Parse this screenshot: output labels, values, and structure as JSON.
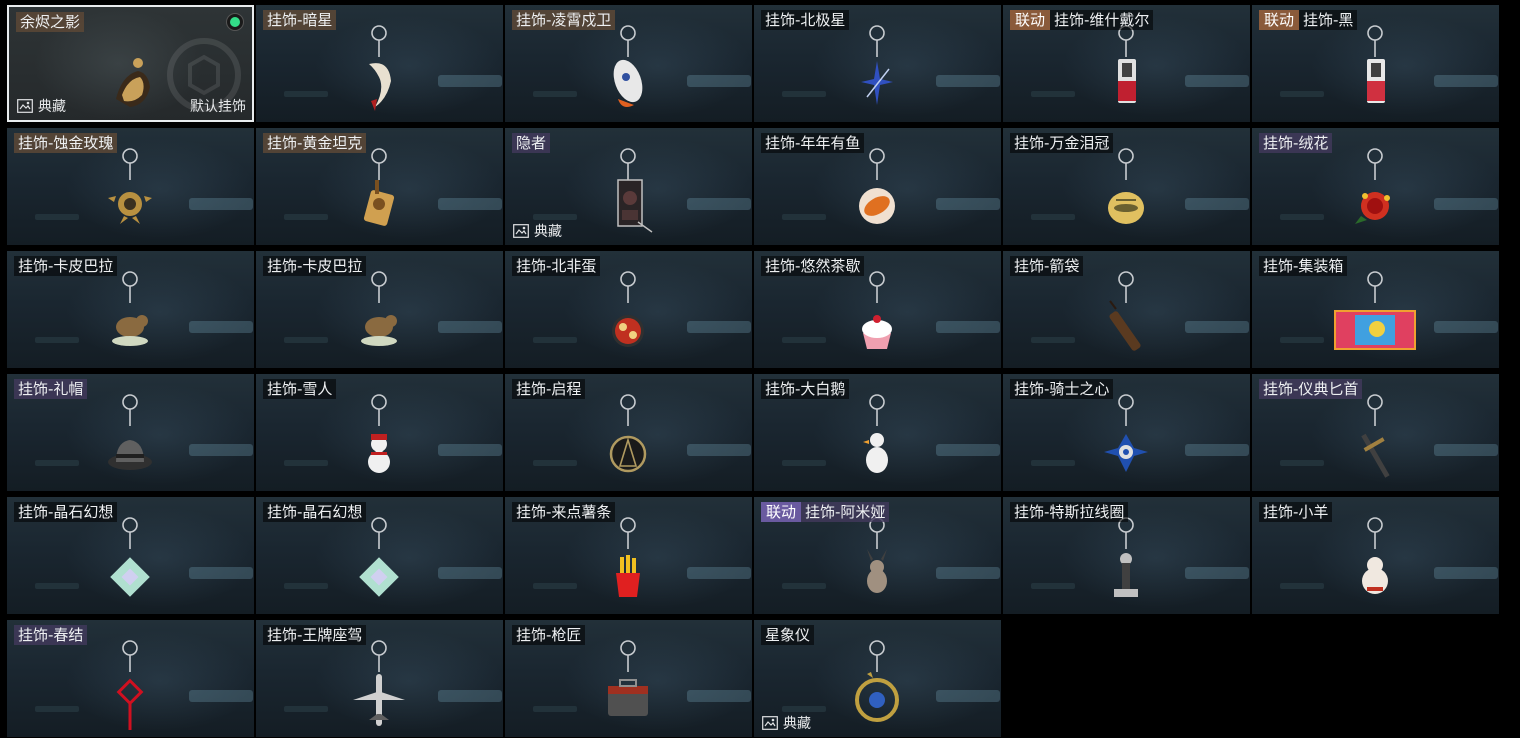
{
  "cards": [
    {
      "name": "余烬之影",
      "collab": "",
      "collab_color": "",
      "label_tint": "warm",
      "selected": true,
      "collection_badge": "典藏",
      "default_label": "默认挂饰",
      "equipped": true,
      "icon": "ember-shadow-figure-icon",
      "colors": [
        "#c9a15a",
        "#3a2a1a"
      ]
    },
    {
      "name": "挂饰-暗星",
      "collab": "",
      "label_tint": "warm",
      "icon": "crescent-moon-icon",
      "colors": [
        "#e8e0d0",
        "#b02020"
      ]
    },
    {
      "name": "挂饰-凌霄戍卫",
      "collab": "",
      "label_tint": "warm",
      "icon": "rocket-icon",
      "colors": [
        "#e8e8e8",
        "#e06020"
      ]
    },
    {
      "name": "挂饰-北极星",
      "collab": "",
      "label_tint": "dark",
      "icon": "north-star-icon",
      "colors": [
        "#3050c0",
        "#c0d0f0"
      ]
    },
    {
      "name": "挂饰-维什戴尔",
      "collab": "联动",
      "collab_color": "#8a5a3a",
      "label_tint": "dark",
      "icon": "gun-charm-icon",
      "colors": [
        "#e0e0e0",
        "#c02030"
      ]
    },
    {
      "name": "挂饰-黑",
      "collab": "联动",
      "collab_color": "#8a5a3a",
      "label_tint": "dark",
      "icon": "gun-charm-icon",
      "colors": [
        "#e8e8e8",
        "#d03040"
      ]
    },
    {
      "name": "挂饰-蚀金玫瑰",
      "collab": "",
      "label_tint": "warm",
      "icon": "gold-rose-icon",
      "colors": [
        "#b89040",
        "#3a3020"
      ]
    },
    {
      "name": "挂饰-黄金坦克",
      "collab": "",
      "label_tint": "warm",
      "icon": "gold-tank-icon",
      "colors": [
        "#d0a050",
        "#7a5020"
      ]
    },
    {
      "name": "隐者",
      "collab": "",
      "label_tint": "violet",
      "collection_badge": "典藏",
      "icon": "tarot-card-icon",
      "colors": [
        "#c0c0c0",
        "#5a3a3a"
      ]
    },
    {
      "name": "挂饰-年年有鱼",
      "collab": "",
      "label_tint": "dark",
      "icon": "fish-plate-icon",
      "colors": [
        "#e07020",
        "#f0e0d0"
      ]
    },
    {
      "name": "挂饰-万金泪冠",
      "collab": "",
      "label_tint": "dark",
      "icon": "gold-crown-icon",
      "colors": [
        "#e0c060",
        "#6a6030"
      ]
    },
    {
      "name": "挂饰-绒花",
      "collab": "",
      "label_tint": "violet",
      "icon": "velvet-flower-icon",
      "colors": [
        "#d03020",
        "#f0c030"
      ]
    },
    {
      "name": "挂饰-卡皮巴拉",
      "collab": "",
      "label_tint": "dark",
      "icon": "capybara-icon",
      "colors": [
        "#8a6a40",
        "#d0d8c0"
      ]
    },
    {
      "name": "挂饰-卡皮巴拉",
      "collab": "",
      "label_tint": "dark",
      "icon": "capybara-icon",
      "colors": [
        "#8a6a40",
        "#d0d8c0"
      ]
    },
    {
      "name": "挂饰-北非蛋",
      "collab": "",
      "label_tint": "dark",
      "icon": "shakshuka-icon",
      "colors": [
        "#c03020",
        "#f0d080"
      ]
    },
    {
      "name": "挂饰-悠然茶歇",
      "collab": "",
      "label_tint": "dark",
      "icon": "cupcake-icon",
      "colors": [
        "#f0a0b0",
        "#ffffff"
      ]
    },
    {
      "name": "挂饰-箭袋",
      "collab": "",
      "label_tint": "dark",
      "icon": "quiver-icon",
      "colors": [
        "#5a3a20",
        "#2a1a10"
      ]
    },
    {
      "name": "挂饰-集装箱",
      "collab": "",
      "label_tint": "dark",
      "icon": "container-icon",
      "colors": [
        "#e04060",
        "#40a0e0"
      ]
    },
    {
      "name": "挂饰-礼帽",
      "collab": "",
      "label_tint": "violet",
      "icon": "fedora-hat-icon",
      "colors": [
        "#606060",
        "#303030"
      ]
    },
    {
      "name": "挂饰-雪人",
      "collab": "",
      "label_tint": "dark",
      "icon": "snowman-icon",
      "colors": [
        "#f0f0f0",
        "#c02020"
      ]
    },
    {
      "name": "挂饰-启程",
      "collab": "",
      "label_tint": "dark",
      "icon": "compass-medal-icon",
      "colors": [
        "#b09a60",
        "#1a1a1a"
      ]
    },
    {
      "name": "挂饰-大白鹅",
      "collab": "",
      "label_tint": "dark",
      "icon": "goose-icon",
      "colors": [
        "#f0f0f0",
        "#f0a030"
      ]
    },
    {
      "name": "挂饰-骑士之心",
      "collab": "",
      "label_tint": "dark",
      "icon": "knight-cross-icon",
      "colors": [
        "#2050b0",
        "#e0e0e0"
      ]
    },
    {
      "name": "挂饰-仪典匕首",
      "collab": "",
      "label_tint": "violet",
      "icon": "dagger-icon",
      "colors": [
        "#404040",
        "#a08040"
      ]
    },
    {
      "name": "挂饰-晶石幻想",
      "collab": "",
      "label_tint": "dark",
      "icon": "crystal-cube-icon",
      "colors": [
        "#b0e0d0",
        "#d0d0f0"
      ]
    },
    {
      "name": "挂饰-晶石幻想",
      "collab": "",
      "label_tint": "dark",
      "icon": "crystal-cube-icon",
      "colors": [
        "#b0e0d0",
        "#d0d0f0"
      ]
    },
    {
      "name": "挂饰-来点薯条",
      "collab": "",
      "label_tint": "dark",
      "icon": "french-fries-icon",
      "colors": [
        "#e02020",
        "#f0c020"
      ]
    },
    {
      "name": "挂饰-阿米娅",
      "collab": "联动",
      "collab_color": "#6a5aa0",
      "label_tint": "violet",
      "icon": "rabbit-icon",
      "colors": [
        "#a09080",
        "#404040"
      ]
    },
    {
      "name": "挂饰-特斯拉线圈",
      "collab": "",
      "label_tint": "dark",
      "icon": "tesla-coil-icon",
      "colors": [
        "#c0c0c0",
        "#404040"
      ]
    },
    {
      "name": "挂饰-小羊",
      "collab": "",
      "label_tint": "dark",
      "icon": "lamb-icon",
      "colors": [
        "#f0e8e0",
        "#c03020"
      ]
    },
    {
      "name": "挂饰-春结",
      "collab": "",
      "label_tint": "violet",
      "icon": "chinese-knot-icon",
      "colors": [
        "#d01020",
        "#c0a060"
      ]
    },
    {
      "name": "挂饰-王牌座驾",
      "collab": "",
      "label_tint": "dark",
      "icon": "jet-plane-icon",
      "colors": [
        "#d0d0d0",
        "#606060"
      ]
    },
    {
      "name": "挂饰-枪匠",
      "collab": "",
      "label_tint": "dark",
      "icon": "toolbox-icon",
      "colors": [
        "#505050",
        "#a03020"
      ]
    },
    {
      "name": "星象仪",
      "collab": "",
      "label_tint": "dark",
      "collection_badge": "典藏",
      "icon": "astrolabe-icon",
      "colors": [
        "#c0a040",
        "#3060c0"
      ]
    }
  ]
}
